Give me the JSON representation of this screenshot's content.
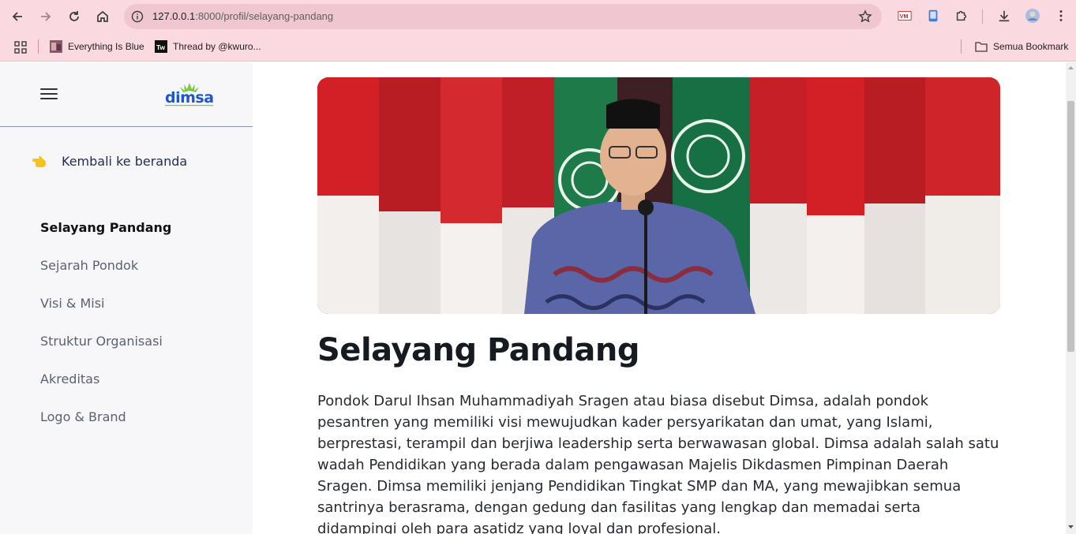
{
  "browser": {
    "url_host": "127.0.0.1",
    "url_path": ":8000/profil/selayang-pandang",
    "bookmarks": [
      {
        "label": "Everything Is Blue",
        "icon": "photo-favicon"
      },
      {
        "label": "Thread by @kwuro...",
        "icon": "tw-favicon"
      }
    ],
    "all_bookmarks_label": "Semua Bookmark",
    "colors": {
      "chrome": "#fbd9e1",
      "omnibox": "#f0c6d1"
    }
  },
  "sidebar": {
    "brand": "dimsa",
    "back_label": "Kembali ke beranda",
    "items": [
      {
        "label": "Selayang Pandang",
        "active": true
      },
      {
        "label": "Sejarah Pondok",
        "active": false
      },
      {
        "label": "Visi & Misi",
        "active": false
      },
      {
        "label": "Struktur Organisasi",
        "active": false
      },
      {
        "label": "Akreditas",
        "active": false
      },
      {
        "label": "Logo & Brand",
        "active": false
      }
    ]
  },
  "main": {
    "title": "Selayang Pandang",
    "body": "Pondok Darul Ihsan Muhammadiyah Sragen atau biasa disebut Dimsa, adalah pondok pesantren yang memiliki visi mewujudkan kader persyarikatan dan umat, yang Islami, berprestasi, terampil dan berjiwa leadership serta berwawasan global. Dimsa adalah salah satu wadah Pendidikan yang berada dalam pengawasan Majelis Dikdasmen Pimpinan Daerah Sragen. Dimsa memiliki jenjang Pendidikan Tingkat SMP dan MA, yang mewajibkan semua santrinya berasrama, dengan gedung dan fasilitas yang lengkap dan memadai serta didampingi oleh para asatidz yang loyal dan profesional."
  }
}
